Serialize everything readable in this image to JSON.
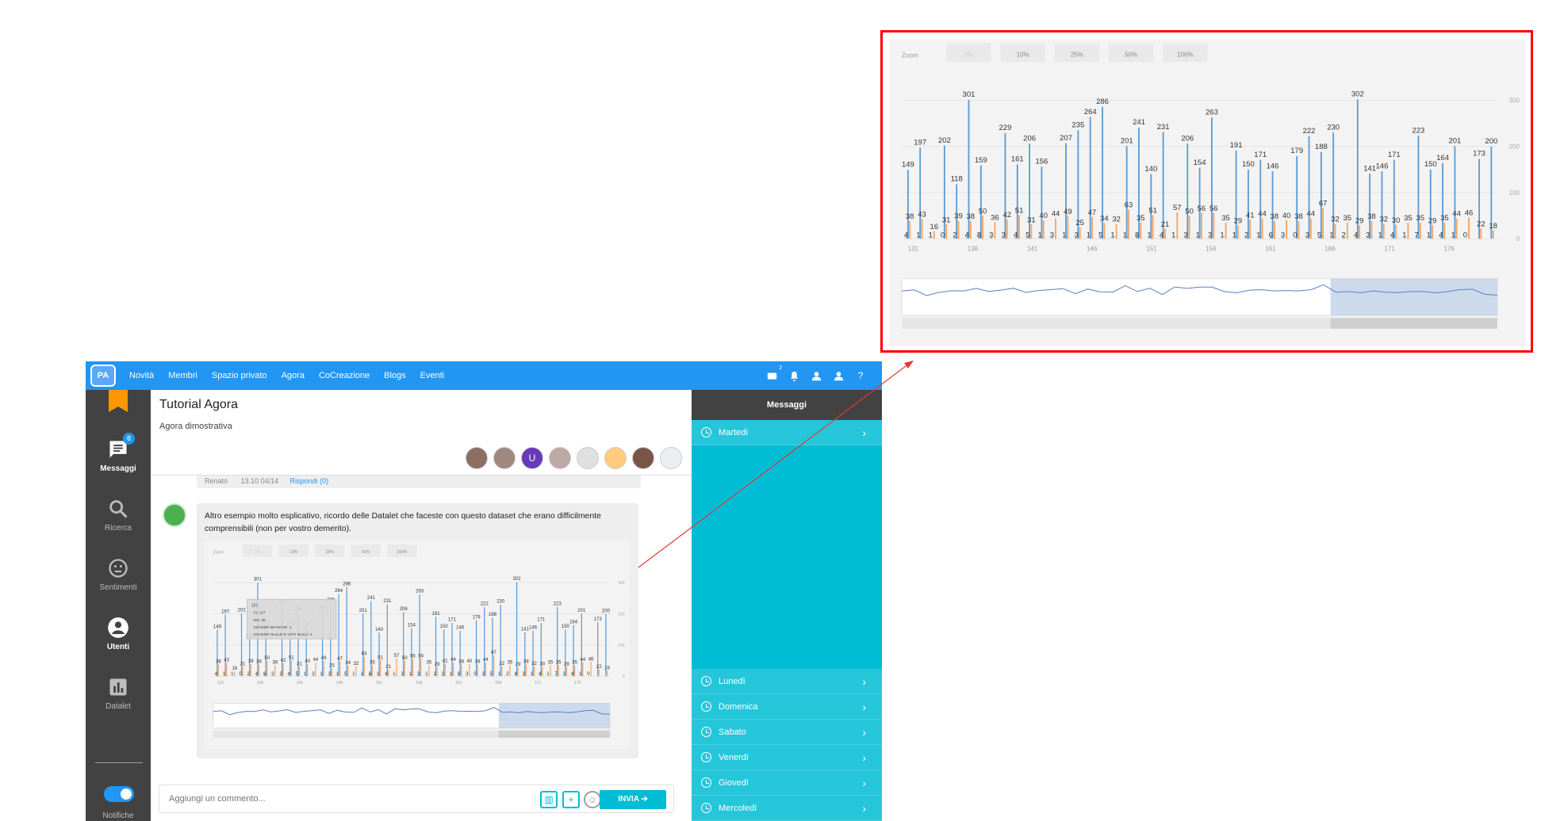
{
  "app": {
    "logo_text": "PA",
    "nav": [
      "Novità",
      "Membri",
      "Spazio privato",
      "Agora",
      "CoCreazione",
      "Blogs",
      "Eventi"
    ],
    "top_icon_badge": "2",
    "help_label": "?"
  },
  "sidebar": {
    "messages_badge": "0",
    "items": [
      {
        "label": "Messaggi",
        "icon": "chat-icon",
        "active": true
      },
      {
        "label": "Ricerca",
        "icon": "search-icon",
        "active": false
      },
      {
        "label": "Sentimenti",
        "icon": "sentiment-icon",
        "active": false
      },
      {
        "label": "Utenti",
        "icon": "user-icon",
        "active": true
      },
      {
        "label": "Datalet",
        "icon": "chart-icon",
        "active": false
      }
    ],
    "toggle_label": "Notifiche"
  },
  "topic": {
    "title": "Tutorial Agora",
    "subtitle": "Agora dimostrativa",
    "avatar_letter": "U"
  },
  "prev_post": {
    "author": "Renato",
    "time": "13.10 04/14",
    "reply": "Rispondi (0)"
  },
  "post": {
    "text": "Altro esempio molto esplicativo, ricordo delle Datalet che faceste con questo dataset che erano difficilmente comprensibili (non per vostro demerito)."
  },
  "composer": {
    "placeholder": "Aggiungi un commento...",
    "send_label": "INVIA"
  },
  "right_panel": {
    "header": "Messaggi",
    "days": [
      "Martedì",
      "Lunedì",
      "Domenica",
      "Sabato",
      "Venerdì",
      "Giovedì",
      "Mercoledì"
    ]
  },
  "tooltip": {
    "title": "131",
    "rows": [
      "SI: 137",
      "NO: 38",
      "SCHEDE BIANCHE: 1",
      "SCHEDE NULLE E VOTI NULLI: 4"
    ]
  },
  "colors": {
    "blue_series": "#5b9bd5",
    "orange_series": "#f4a460",
    "accent": "#2196f3",
    "teal": "#00bcd4"
  },
  "chart_data": {
    "type": "bar",
    "zoom_label": "Zoom",
    "zoom_options": [
      "1%",
      "10%",
      "25%",
      "50%",
      "100%"
    ],
    "x_tick_labels": [
      "131",
      "136",
      "141",
      "146",
      "151",
      "156",
      "161",
      "166",
      "171",
      "176"
    ],
    "y_tick_labels": [
      "0",
      "100",
      "200",
      "300"
    ],
    "ylim": [
      0,
      320
    ],
    "series": [
      {
        "values": [
          149,
          197,
          202,
          118,
          301,
          159,
          229,
          161,
          206,
          156,
          207,
          235,
          264,
          286,
          201,
          241,
          140,
          231,
          206,
          154,
          263,
          191,
          150,
          171,
          146,
          179,
          222,
          188,
          230,
          302,
          141,
          146,
          171,
          223,
          150,
          164,
          201,
          173,
          200
        ]
      },
      {
        "values": [
          38,
          43,
          16,
          31,
          39,
          38,
          50,
          36,
          42,
          51,
          31,
          40,
          44,
          49,
          25,
          47,
          34,
          32,
          63,
          35,
          51,
          21,
          57,
          50,
          56,
          56,
          35,
          29,
          41,
          44,
          38,
          40,
          38,
          44,
          67,
          32,
          35,
          29,
          38,
          32,
          30,
          35,
          35,
          29,
          35,
          44,
          46,
          22,
          18
        ]
      },
      {
        "values": [
          4,
          1,
          1,
          0,
          2,
          4,
          8,
          3,
          3,
          4,
          5,
          1,
          3,
          1,
          3,
          1,
          5,
          1,
          1,
          8,
          1,
          4,
          1,
          3,
          1,
          3,
          1,
          1,
          2,
          1,
          6,
          3,
          0,
          3,
          5,
          1,
          2,
          4,
          3,
          1,
          4,
          1,
          7,
          1,
          4,
          1,
          0
        ]
      }
    ]
  }
}
